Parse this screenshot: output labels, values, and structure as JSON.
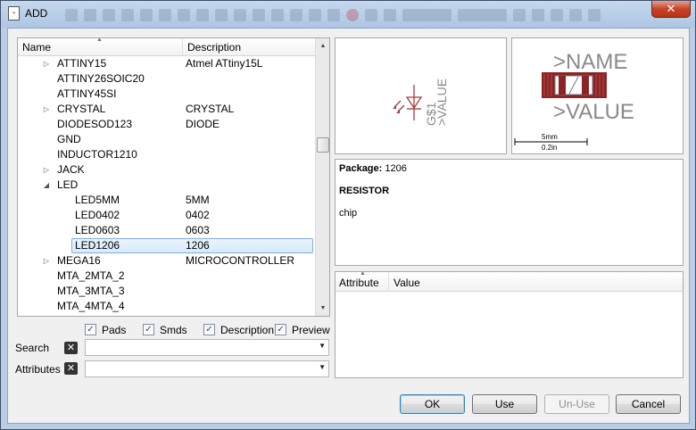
{
  "window": {
    "title": "ADD",
    "app_icon": "eagle-app-icon",
    "close_glyph": "✕"
  },
  "tree": {
    "headers": {
      "name": "Name",
      "description": "Description"
    },
    "rows": [
      {
        "name": "ATTINY15",
        "description": "Atmel ATtiny15L",
        "expander": "▷",
        "level": 0
      },
      {
        "name": "ATTINY26SOIC20",
        "description": "",
        "expander": "",
        "level": 0
      },
      {
        "name": "ATTINY45SI",
        "description": "",
        "expander": "",
        "level": 0
      },
      {
        "name": "CRYSTAL",
        "description": "CRYSTAL",
        "expander": "▷",
        "level": 0
      },
      {
        "name": "DIODESOD123",
        "description": "DIODE",
        "expander": "",
        "level": 0
      },
      {
        "name": "GND",
        "description": "",
        "expander": "",
        "level": 0
      },
      {
        "name": "INDUCTOR1210",
        "description": "",
        "expander": "",
        "level": 0
      },
      {
        "name": "JACK",
        "description": "",
        "expander": "▷",
        "level": 0
      },
      {
        "name": "LED",
        "description": "",
        "expander": "◢",
        "level": 0
      },
      {
        "name": "LED5MM",
        "description": "5MM",
        "expander": "",
        "level": 1
      },
      {
        "name": "LED0402",
        "description": "0402",
        "expander": "",
        "level": 1
      },
      {
        "name": "LED0603",
        "description": "0603",
        "expander": "",
        "level": 1
      },
      {
        "name": "LED1206",
        "description": "1206",
        "expander": "",
        "level": 1,
        "selected": true
      },
      {
        "name": "MEGA16",
        "description": "MICROCONTROLLER",
        "expander": "▷",
        "level": 0
      },
      {
        "name": "MTA_2MTA_2",
        "description": "",
        "expander": "",
        "level": 0
      },
      {
        "name": "MTA_3MTA_3",
        "description": "",
        "expander": "",
        "level": 0
      },
      {
        "name": "MTA_4MTA_4",
        "description": "",
        "expander": "",
        "level": 0
      }
    ]
  },
  "options": {
    "pads": {
      "label": "Pads",
      "checked": true
    },
    "smds": {
      "label": "Smds",
      "checked": true
    },
    "description": {
      "label": "Description",
      "checked": true
    },
    "preview": {
      "label": "Preview",
      "checked": true
    },
    "check_glyph": "✓"
  },
  "search": {
    "label": "Search",
    "value": ""
  },
  "attributes_filter": {
    "label": "Attributes",
    "value": ""
  },
  "symbol_preview": {
    "name_text": "G$1",
    "value_text": ">VALUE"
  },
  "package_preview": {
    "name_text": ">NAME",
    "value_text": ">VALUE",
    "scale_mm": "5mm",
    "scale_in": "0.2in"
  },
  "info": {
    "package_label": "Package:",
    "package_value": "1206",
    "title": "RESISTOR",
    "description": "chip"
  },
  "attribute_table": {
    "headers": {
      "attribute": "Attribute",
      "value": "Value"
    }
  },
  "buttons": {
    "ok": "OK",
    "use": "Use",
    "unuse": "Un-Use",
    "cancel": "Cancel"
  },
  "colors": {
    "symbol": "#a33b3b",
    "package_pad": "#8b2424",
    "selection": "#d6eafc"
  }
}
